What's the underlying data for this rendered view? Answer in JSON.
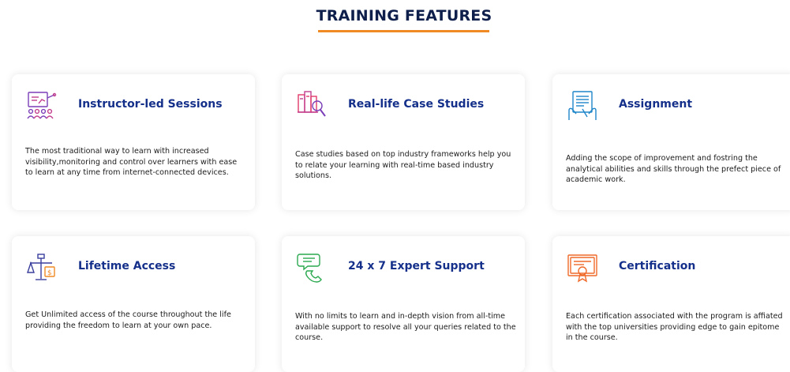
{
  "section": {
    "title": "TRAINING FEATURES",
    "accent_color": "#f08a24",
    "title_color": "#0f1f4b",
    "card_title_color": "#15308a"
  },
  "features": [
    {
      "icon": "presentation-board-icon",
      "title": "Instructor-led Sessions",
      "description": "The most traditional way to learn with increased visibility,monitoring and control over learners with ease to learn at any time from internet-connected devices."
    },
    {
      "icon": "case-study-magnifier-icon",
      "title": "Real-life Case Studies",
      "description": "Case studies based on top industry frameworks help you to relate your learning with real-time based industry solutions."
    },
    {
      "icon": "assignment-document-icon",
      "title": "Assignment",
      "description": "Adding the scope of improvement and fostring the analytical abilities and skills through the prefect piece of academic work."
    },
    {
      "icon": "balance-scale-icon",
      "title": "Lifetime Access",
      "description": "Get Unlimited access of the course throughout the life providing the freedom to learn at your own pace."
    },
    {
      "icon": "phone-chat-support-icon",
      "title": "24 x 7 Expert Support",
      "description": "With no limits to learn and in-depth vision from all-time available support to resolve all your queries related to the course."
    },
    {
      "icon": "certificate-icon",
      "title": "Certification",
      "description": "Each certification associated with the program is affiated with the top universities providing edge to gain epitome in the course."
    }
  ]
}
